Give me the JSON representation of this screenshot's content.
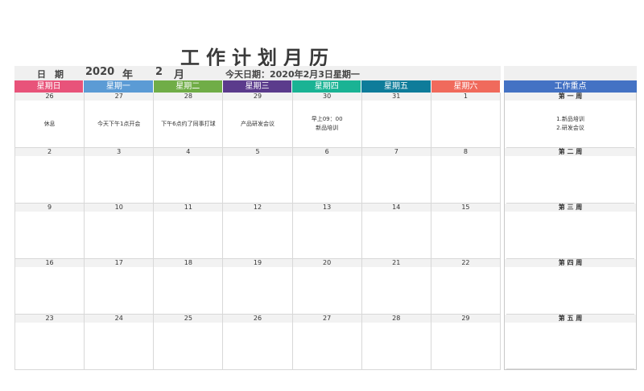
{
  "title": "工作计划月历",
  "info": {
    "date_label": "日　期",
    "year": "2020",
    "year_unit": "年",
    "month": "2",
    "month_unit": "月",
    "today": "今天日期：2020年2月3日星期一"
  },
  "weekdays": [
    {
      "label": "星期日",
      "color": "#e8537a"
    },
    {
      "label": "星期一",
      "color": "#5b9bd5"
    },
    {
      "label": "星期二",
      "color": "#70ad47"
    },
    {
      "label": "星期三",
      "color": "#5b3b8c"
    },
    {
      "label": "星期四",
      "color": "#1ab394"
    },
    {
      "label": "星期五",
      "color": "#0e7c9a"
    },
    {
      "label": "星期六",
      "color": "#f06a5c"
    }
  ],
  "sidebar": {
    "header": "工作重点",
    "header_color": "#4472c4",
    "weeks": [
      {
        "label": "第 一 周",
        "note": "1.新品培训\n2.研发会议"
      },
      {
        "label": "第 二 周",
        "note": ""
      },
      {
        "label": "第 三 周",
        "note": ""
      },
      {
        "label": "第 四 周",
        "note": ""
      },
      {
        "label": "第 五 周",
        "note": ""
      }
    ]
  },
  "calendar": [
    {
      "days": [
        "26",
        "27",
        "28",
        "29",
        "30",
        "31",
        "1"
      ],
      "events": [
        "休息",
        "今天下午1点开会",
        "下午6点约了同事打球",
        "产品研发会议",
        "早上09：00\n新品培训",
        "",
        ""
      ]
    },
    {
      "days": [
        "2",
        "3",
        "4",
        "5",
        "6",
        "7",
        "8"
      ],
      "events": [
        "",
        "",
        "",
        "",
        "",
        "",
        ""
      ]
    },
    {
      "days": [
        "9",
        "10",
        "11",
        "12",
        "13",
        "14",
        "15"
      ],
      "events": [
        "",
        "",
        "",
        "",
        "",
        "",
        ""
      ]
    },
    {
      "days": [
        "16",
        "17",
        "18",
        "19",
        "20",
        "21",
        "22"
      ],
      "events": [
        "",
        "",
        "",
        "",
        "",
        "",
        ""
      ]
    },
    {
      "days": [
        "23",
        "24",
        "25",
        "26",
        "27",
        "28",
        "29"
      ],
      "events": [
        "",
        "",
        "",
        "",
        "",
        "",
        ""
      ]
    }
  ]
}
